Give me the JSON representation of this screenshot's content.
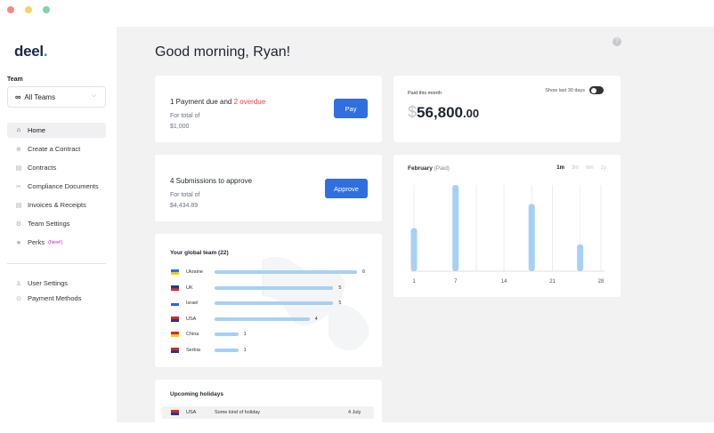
{
  "window": {
    "dots": [
      "#f28b82",
      "#f6d365",
      "#7fd4a8"
    ]
  },
  "sidebar": {
    "logo": "deel",
    "logo_dot": ".",
    "team_label": "Team",
    "team_select": {
      "icon": "infinity-icon",
      "value": "All Teams"
    },
    "items": [
      {
        "label": "Home",
        "icon": "home-icon",
        "active": true
      },
      {
        "label": "Create a Contract",
        "icon": "plus-circle-icon"
      },
      {
        "label": "Contracts",
        "icon": "document-icon"
      },
      {
        "label": "Compliance Documents",
        "icon": "tools-icon"
      },
      {
        "label": "Invoices & Receipts",
        "icon": "receipt-icon"
      },
      {
        "label": "Team Settings",
        "icon": "gear-icon"
      },
      {
        "label": "Perks",
        "icon": "star-icon",
        "badge": "(New!)"
      }
    ],
    "bottom_items": [
      {
        "label": "User Settings",
        "icon": "user-icon"
      },
      {
        "label": "Payment Methods",
        "icon": "card-icon"
      }
    ]
  },
  "main": {
    "greeting": "Good morning, Ryan!",
    "help": "?",
    "payment_card": {
      "title_prefix": "1 Payment due and ",
      "overdue": "2 overdue",
      "sub_label": "For total of",
      "amount": "$1,000",
      "button": "Pay"
    },
    "submissions_card": {
      "title": "4 Submissions to approve",
      "sub_label": "For total of",
      "amount": "$4,434.89",
      "button": "Approve"
    },
    "paid_card": {
      "label": "Paid this month",
      "toggle_label": "Show last 30 days",
      "currency": "$",
      "amount": "56,800",
      "cents": ".00"
    },
    "global_team": {
      "title": "Your global team (22)",
      "rows": [
        {
          "country": "Ukraine",
          "count": 6,
          "flag": [
            "#2f6fe0",
            "#f6d000"
          ]
        },
        {
          "country": "UK",
          "count": 5,
          "flag": [
            "#1e3a8a",
            "#dc2626"
          ]
        },
        {
          "country": "Israel",
          "count": 5,
          "flag": [
            "#ffffff",
            "#2563eb"
          ]
        },
        {
          "country": "USA",
          "count": 4,
          "flag": [
            "#dc2626",
            "#1e3a8a"
          ]
        },
        {
          "country": "China",
          "count": 1,
          "flag": [
            "#dc2626",
            "#facc15"
          ]
        },
        {
          "country": "Serbia",
          "count": 1,
          "flag": [
            "#dc2626",
            "#1e3a8a"
          ]
        }
      ]
    },
    "holidays": {
      "title": "Upcoming holidays",
      "rows": [
        {
          "country": "USA",
          "name": "Some kind of holiday",
          "date": "4 July"
        }
      ]
    },
    "chart_card": {
      "title": "February",
      "title_suffix": " (Paid)",
      "ranges": [
        "1m",
        "3m",
        "6m",
        "1y"
      ],
      "active_range": "1m"
    }
  },
  "chart_data": {
    "type": "bar",
    "x_ticks": [
      "1",
      "7",
      "14",
      "21",
      "28"
    ],
    "bars": [
      {
        "x": 1,
        "value": 0.5
      },
      {
        "x": 7,
        "value": 1.0
      },
      {
        "x": 18,
        "value": 0.78
      },
      {
        "x": 25,
        "value": 0.31
      }
    ],
    "ylim": [
      0,
      1
    ],
    "grid_x": [
      1,
      7,
      10,
      14,
      18,
      21,
      25,
      28
    ],
    "bar_color": "#a7d0f5"
  }
}
